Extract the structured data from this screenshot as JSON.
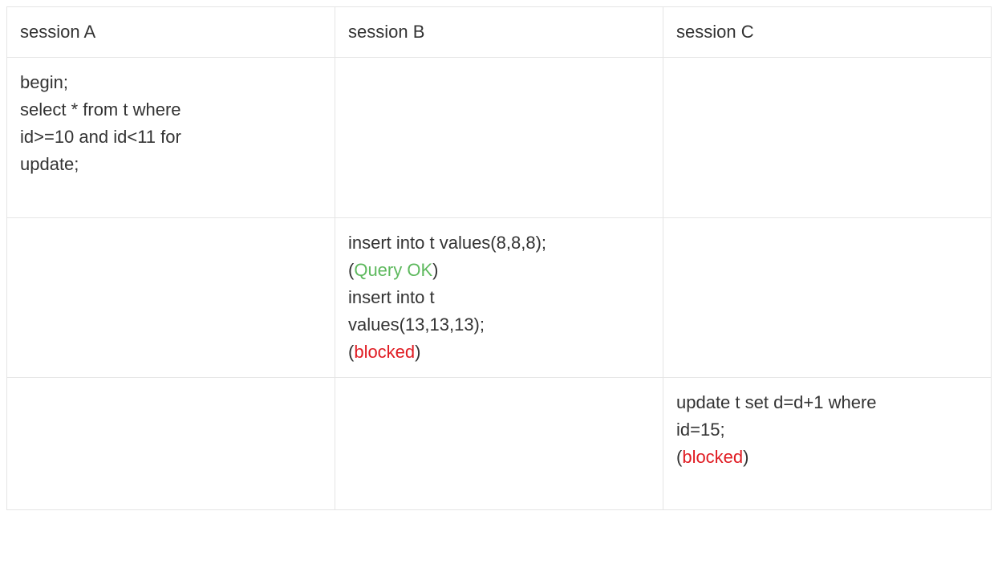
{
  "headers": {
    "a": "session A",
    "b": "session B",
    "c": "session C"
  },
  "row1": {
    "a_line1": "begin;",
    "a_line2": "select * from t where",
    "a_line3": "id>=10 and id<11 for",
    "a_line4": "update;"
  },
  "row2": {
    "b_line1": "insert into t values(8,8,8);",
    "b_status1_open": "(",
    "b_status1_text": "Query OK",
    "b_status1_close": ")",
    "b_line3": "insert into t",
    "b_line4": "values(13,13,13);",
    "b_status2_open": "(",
    "b_status2_text": "blocked",
    "b_status2_close": ")"
  },
  "row3": {
    "c_line1": "update t set d=d+1 where",
    "c_line2": "id=15;",
    "c_status_open": "(",
    "c_status_text": "blocked",
    "c_status_close": ")"
  },
  "colors": {
    "ok": "#5eb95e",
    "blocked": "#e01b22",
    "border": "#e5e5e5",
    "text": "#333333"
  }
}
